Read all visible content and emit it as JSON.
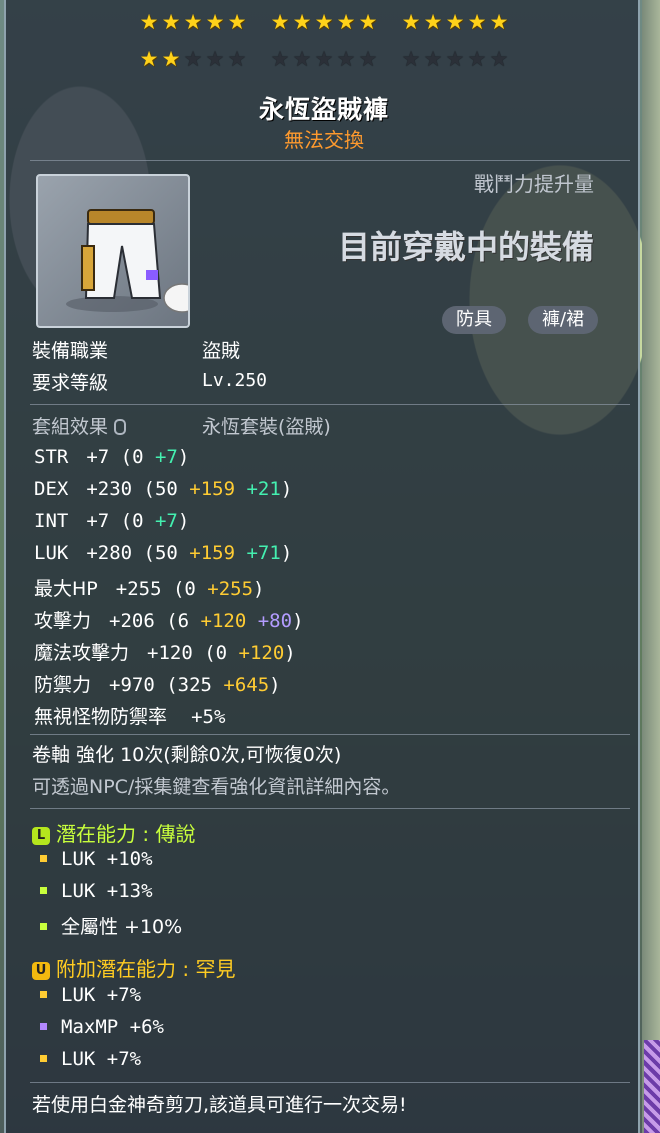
{
  "stars": {
    "filled": 17,
    "total": 30,
    "rows": [
      [
        5,
        5,
        5
      ],
      [
        5,
        5,
        5
      ]
    ]
  },
  "item": {
    "name": "永恆盜賊褲",
    "trade_status": "無法交換",
    "power_label": "戰鬥力提升量",
    "power_value": "目前穿戴中的裝備",
    "tags": [
      "防具",
      "褲/裙"
    ],
    "icon": "pants-icon"
  },
  "requirements": {
    "job_label": "裝備職業",
    "job_value": "盜賊",
    "level_label": "要求等級",
    "level_value": "Lv.250"
  },
  "set": {
    "label": "套組效果",
    "value": "永恆套裝(盜賊)"
  },
  "stats": [
    {
      "name": "STR",
      "total": "+7",
      "base": "0",
      "bonus": "",
      "extra": "+7",
      "extra_color": "green"
    },
    {
      "name": "DEX",
      "total": "+230",
      "base": "50",
      "bonus": "+159",
      "extra": "+21",
      "extra_color": "green"
    },
    {
      "name": "INT",
      "total": "+7",
      "base": "0",
      "bonus": "",
      "extra": "+7",
      "extra_color": "green"
    },
    {
      "name": "LUK",
      "total": "+280",
      "base": "50",
      "bonus": "+159",
      "extra": "+71",
      "extra_color": "green"
    },
    {
      "name": "最大HP",
      "total": "+255",
      "base": "0",
      "bonus": "+255",
      "extra": "",
      "extra_color": ""
    },
    {
      "name": "攻擊力",
      "total": "+206",
      "base": "6",
      "bonus": "+120",
      "extra": "+80",
      "extra_color": "purple"
    },
    {
      "name": "魔法攻擊力",
      "total": "+120",
      "base": "0",
      "bonus": "+120",
      "extra": "",
      "extra_color": ""
    },
    {
      "name": "防禦力",
      "total": "+970",
      "base": "325",
      "bonus": "+645",
      "extra": "",
      "extra_color": ""
    }
  ],
  "ignore_def": {
    "label": "無視怪物防禦率",
    "value": "+5%"
  },
  "scroll": {
    "line": "卷軸 強化 10次(剩餘0次,可恢復0次)",
    "hint": "可透過NPC/採集鍵查看強化資訊詳細內容。"
  },
  "potential": {
    "badge": "L",
    "title": "潛在能力 : 傳說",
    "lines": [
      "LUK +10%",
      "LUK +13%",
      "全屬性 +10%"
    ],
    "bullet_colors": [
      "#ffcc33",
      "#c8ff3c",
      "#c8ff3c"
    ]
  },
  "bonus_potential": {
    "badge": "U",
    "title": "附加潛在能力 : 罕見",
    "lines": [
      "LUK +7%",
      "MaxMP +6%",
      "LUK +7%"
    ],
    "bullet_colors": [
      "#ffcc33",
      "#b388ff",
      "#ffcc33"
    ]
  },
  "footer": "若使用白金神奇剪刀,該道具可進行一次交易!",
  "colors": {
    "accent_yellow": "#ffcc33",
    "accent_green": "#44f0b0",
    "trade_orange": "#ff9a2e"
  }
}
